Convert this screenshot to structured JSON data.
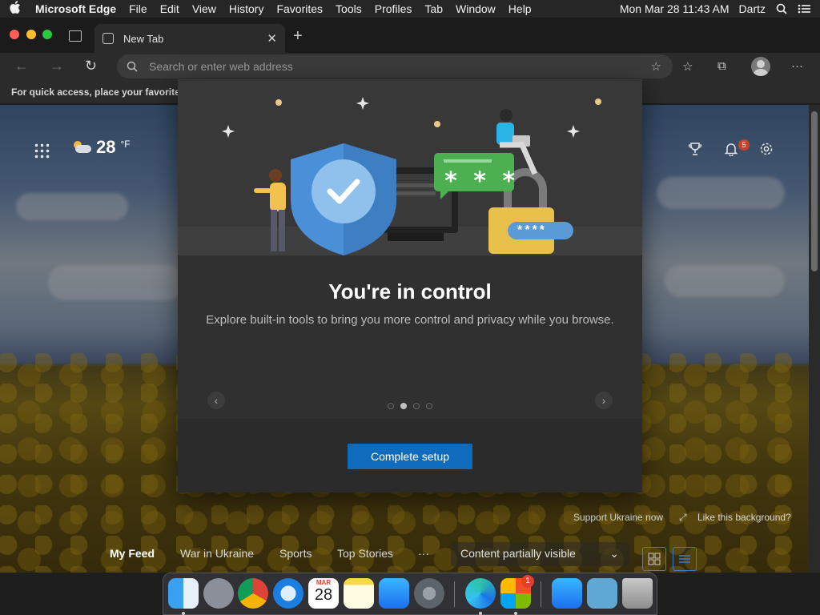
{
  "menubar": {
    "app_name": "Microsoft Edge",
    "items": [
      "File",
      "Edit",
      "View",
      "History",
      "Favorites",
      "Tools",
      "Profiles",
      "Tab",
      "Window",
      "Help"
    ],
    "clock": "Mon Mar 28  11:43 AM",
    "user": "Dartz"
  },
  "browser": {
    "tab_title": "New Tab",
    "address_placeholder": "Search or enter web address",
    "favorites_bar_text": "For quick access, place your favorite"
  },
  "newtab": {
    "weather_temp": "28",
    "weather_unit": "°F",
    "notification_count": "5",
    "support_link": "Support Ukraine now",
    "background_link": "Like this background?",
    "feed_tabs": [
      "My Feed",
      "War in Ukraine",
      "Sports",
      "Top Stories",
      "···"
    ],
    "content_select": "Content partially visible"
  },
  "modal": {
    "title": "You're in control",
    "description": "Explore built-in tools to bring you more control and privacy while you browse.",
    "button_label": "Complete setup",
    "password_mask": "****",
    "chat_mask": "* * *",
    "carousel_active_index": 1,
    "carousel_count": 4
  },
  "dock": {
    "calendar_month": "MAR",
    "calendar_day": "28",
    "store_badge": "1"
  },
  "colors": {
    "accent": "#0f6cbd",
    "modal_bg": "#303030",
    "shield": "#4a90d9",
    "chat_bubble": "#4caf50",
    "lock": "#e8c04a"
  }
}
